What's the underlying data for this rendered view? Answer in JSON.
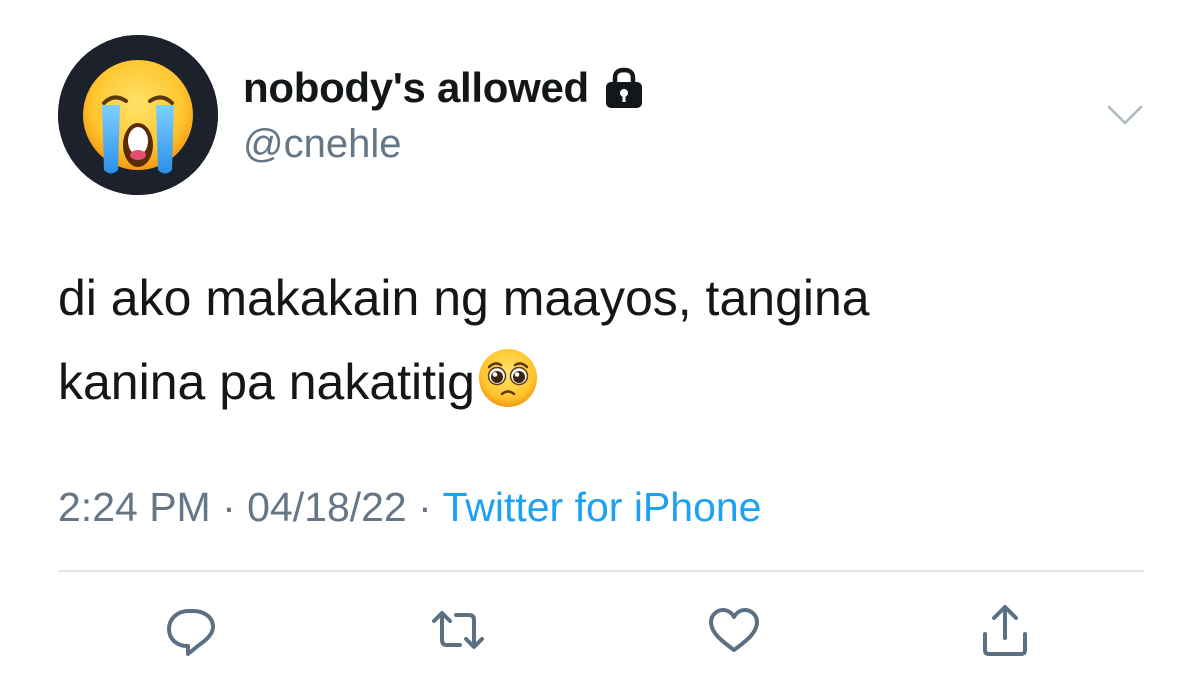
{
  "user": {
    "display_name": "nobody's allowed",
    "handle": "@cnehle",
    "avatar_icon": "loudly-crying-face-emoji",
    "protected_icon": "lock-icon"
  },
  "tweet": {
    "text_line_1": "di ako makakain ng maayos, tangina",
    "text_line_2": "kanina pa nakatitig",
    "trailing_emoji": "pleading-face-emoji"
  },
  "meta": {
    "time": "2:24 PM",
    "separator": " · ",
    "date": "04/18/22",
    "source": "Twitter for iPhone"
  },
  "actions": [
    {
      "name": "reply",
      "icon": "reply-icon"
    },
    {
      "name": "retweet",
      "icon": "retweet-icon"
    },
    {
      "name": "like",
      "icon": "heart-icon"
    },
    {
      "name": "share",
      "icon": "share-icon"
    }
  ],
  "colors": {
    "text": "#14171a",
    "secondary": "#657786",
    "link": "#1da1f2",
    "divider": "#e1e8ed",
    "icon": "#5b7083"
  }
}
